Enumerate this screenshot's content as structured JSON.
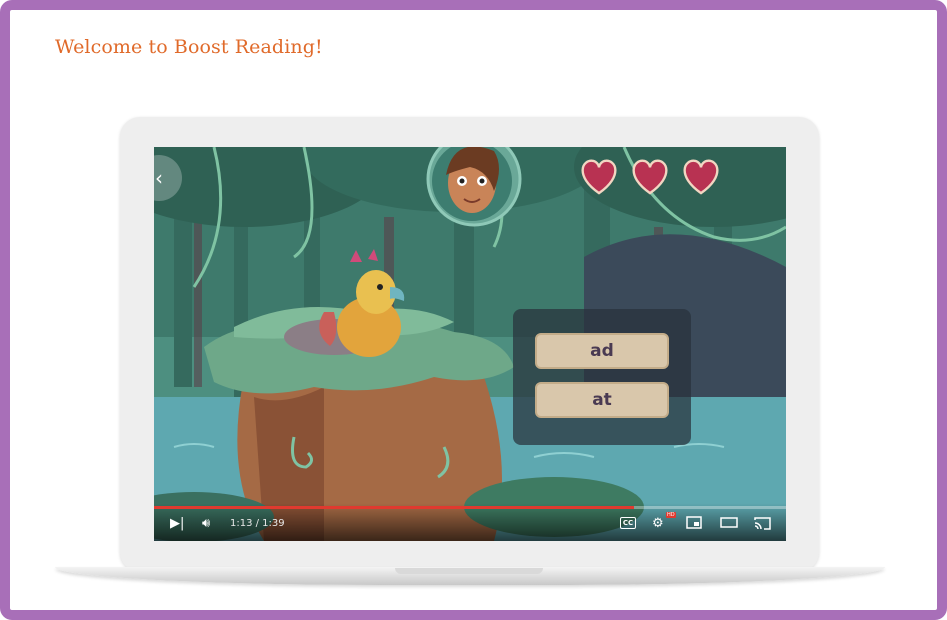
{
  "page": {
    "title": "Welcome to Boost Reading!",
    "border_color": "#a86fb8",
    "title_color": "#e06a2a"
  },
  "game": {
    "answers": [
      "ad",
      "at"
    ],
    "lives": 3,
    "back_icon": "chevron-left-icon"
  },
  "player": {
    "time_display": "1:13 / 1:39",
    "progress_fraction": 0.76,
    "progress_color": "#e03a2f",
    "controls": [
      "next-icon",
      "volume-icon",
      "captions-icon",
      "settings-icon",
      "miniplayer-icon",
      "theater-icon",
      "cast-icon"
    ],
    "settings_badge": "HD",
    "captions_label": "CC"
  }
}
